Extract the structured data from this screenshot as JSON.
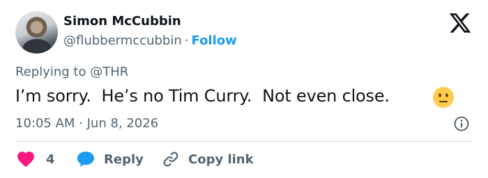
{
  "author": {
    "name": "Simon McCubbin",
    "handle": "@flubbermccubbin",
    "separator": "·",
    "follow_label": "Follow"
  },
  "tweet": {
    "replying_to": "Replying to @THR",
    "text": "I’m sorry.  He’s no Tim Curry.  Not even close.",
    "emoji_icon": "neutral-face-emoji",
    "timestamp": "10:05 AM · Jun 8, 2026"
  },
  "actions": {
    "like_count": "4",
    "reply_label": "Reply",
    "copy_label": "Copy link"
  },
  "colors": {
    "accent": "#1d9bf0",
    "like": "#f91880",
    "muted_text": "#536471",
    "text": "#0f1419"
  }
}
